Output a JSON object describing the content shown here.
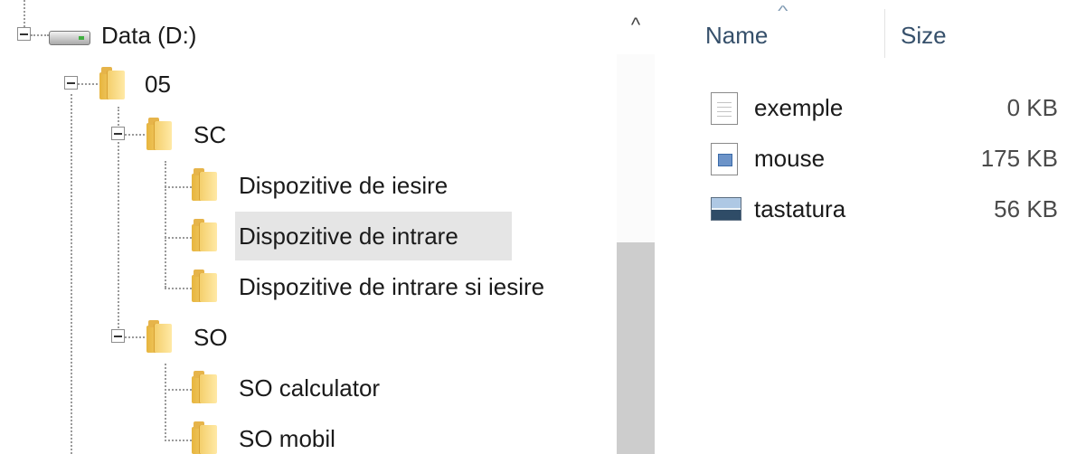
{
  "tree": {
    "drive": {
      "label": "Data (D:)",
      "icon": "drive-icon"
    },
    "nodes": [
      {
        "label": "05",
        "icon": "folder-icon",
        "expanded": true
      },
      {
        "label": "SC",
        "icon": "folder-icon",
        "expanded": true
      },
      {
        "label": "Dispozitive de iesire",
        "icon": "folder-icon"
      },
      {
        "label": "Dispozitive de intrare",
        "icon": "folder-icon",
        "selected": true
      },
      {
        "label": "Dispozitive de intrare si iesire",
        "icon": "folder-icon"
      },
      {
        "label": "SO",
        "icon": "folder-icon",
        "expanded": true
      },
      {
        "label": "SO calculator",
        "icon": "folder-icon"
      },
      {
        "label": "SO mobil",
        "icon": "folder-icon"
      }
    ]
  },
  "scrollbar": {
    "up_arrow": "^"
  },
  "file_list": {
    "columns": {
      "name": "Name",
      "size": "Size"
    },
    "sort_indicator": "^",
    "files": [
      {
        "name": "exemple",
        "size": "0 KB",
        "icon": "text-document-icon"
      },
      {
        "name": "mouse",
        "size": "175 KB",
        "icon": "application-icon"
      },
      {
        "name": "tastatura",
        "size": "56 KB",
        "icon": "image-file-icon"
      }
    ]
  }
}
